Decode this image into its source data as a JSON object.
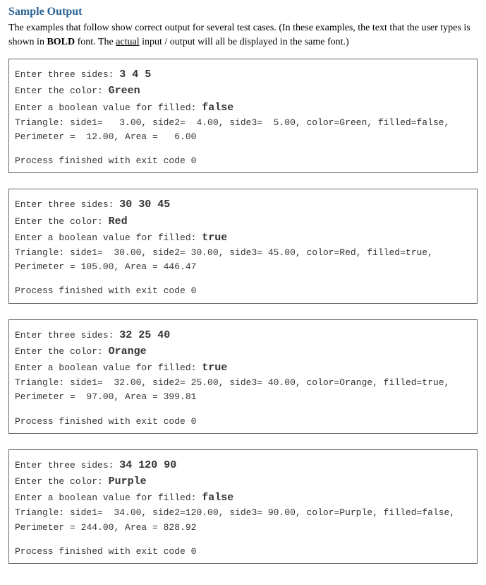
{
  "heading": "Sample Output",
  "intro": {
    "part1": "The examples that follow show correct output for several test cases.  (In these examples, the text that the user types is shown in ",
    "bold": "BOLD",
    "part2": " font.  The ",
    "underline": "actual",
    "part3": " input / output will all be displayed in the same font.)"
  },
  "samples": [
    {
      "prompt_sides": "Enter three sides: ",
      "input_sides": "3 4 5",
      "prompt_color": "Enter the color: ",
      "input_color": "Green",
      "prompt_filled": "Enter a boolean value for filled: ",
      "input_filled": "false",
      "result_line1": "Triangle: side1=   3.00, side2=  4.00, side3=  5.00, color=Green, filled=false,",
      "result_line2": "Perimeter =  12.00, Area =   6.00",
      "exit": "Process finished with exit code 0"
    },
    {
      "prompt_sides": "Enter three sides: ",
      "input_sides": "30 30 45",
      "prompt_color": "Enter the color: ",
      "input_color": "Red",
      "prompt_filled": "Enter a boolean value for filled: ",
      "input_filled": "true",
      "result_line1": "Triangle: side1=  30.00, side2= 30.00, side3= 45.00, color=Red, filled=true,",
      "result_line2": "Perimeter = 105.00, Area = 446.47",
      "exit": "Process finished with exit code 0"
    },
    {
      "prompt_sides": "Enter three sides: ",
      "input_sides": "32 25 40",
      "prompt_color": "Enter the color: ",
      "input_color": "Orange",
      "prompt_filled": "Enter a boolean value for filled: ",
      "input_filled": "true",
      "result_line1": "Triangle: side1=  32.00, side2= 25.00, side3= 40.00, color=Orange, filled=true,",
      "result_line2": "Perimeter =  97.00, Area = 399.81",
      "exit": "Process finished with exit code 0"
    },
    {
      "prompt_sides": "Enter three sides: ",
      "input_sides": "34 120 90",
      "prompt_color": "Enter the color: ",
      "input_color": "Purple",
      "prompt_filled": "Enter a boolean value for filled: ",
      "input_filled": "false",
      "result_line1": "Triangle: side1=  34.00, side2=120.00, side3= 90.00, color=Purple, filled=false,",
      "result_line2": "Perimeter = 244.00, Area = 828.92",
      "exit": "Process finished with exit code 0"
    }
  ]
}
